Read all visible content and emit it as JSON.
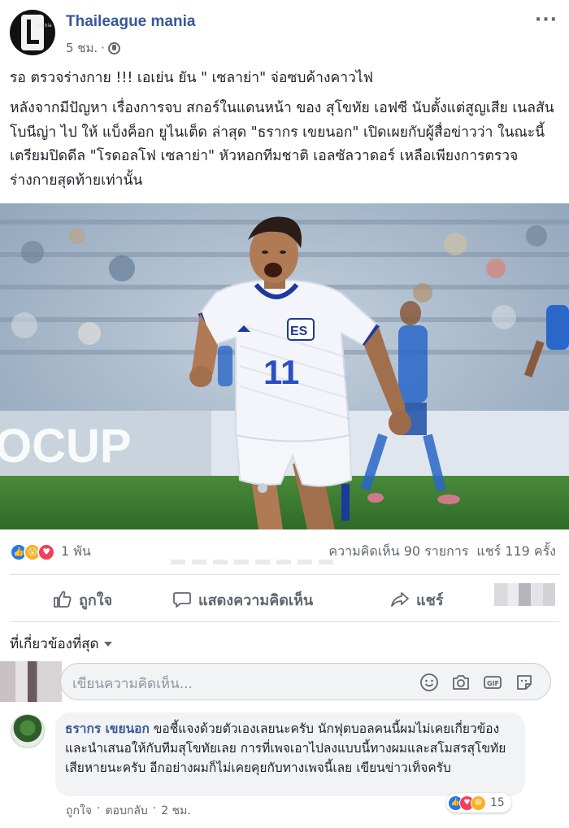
{
  "page": {
    "name": "Thaileague mania",
    "logo_text": "mania",
    "time": "5 ชม.",
    "dot": "·"
  },
  "post": {
    "title": "รอ ตรวจร่างกาย !!! เอเย่น ยัน \" เซลาย่า\" จ่อซบค้างคาวไฟ",
    "body": "หลังจากมีปัญหา เรื่องการจบ สกอร์ในแดนหน้า ของ สุโขทัย เอฟซี นับตั้งแต่สูญเสีย เนลสัน โบนีญ่า ไป ให้ แบ็งค็อก ยูไนเต็ด ล่าสุด \"ธรากร เขยนอก\" เปิดเผยกับผู้สื่อข่าวว่า ในณะนี้ เตรียมปิดดีล \"โรดอลโฟ เซลาย่า\" หัวหอกทีมชาติ เอลซัลวาดอร์ เหลือเพียงการตรวจร่างกายสุดท้ายเท่านั้น",
    "photo": {
      "jersey_text": "ES",
      "jersey_number": "11",
      "banner_text": "OCUP"
    }
  },
  "stats": {
    "reactions_count": "1 พัน",
    "comments": "ความคิดเห็น 90 รายการ",
    "shares": "แชร์ 119 ครั้ง"
  },
  "actions": {
    "like": "ถูกใจ",
    "comment": "แสดงความคิดเห็น",
    "share": "แชร์"
  },
  "comments_section": {
    "sort_label": "ที่เกี่ยวข้องที่สุด",
    "placeholder": "เขียนความคิดเห็น..."
  },
  "reply": {
    "author": "ธรากร เขยนอก",
    "text": "ขอชี้แจงด้วยตัวเองเลยนะครับ นักฟุตบอลคนนี้ผมไม่เคยเกี่ยวข้อง และนำเสนอให้กับทีมสุโขทัยเลย การที่เพจเอาไปลงแบบนี้ทางผมและสโมสรสุโขทัยเสียหายนะครับ อีกอย่างผมก็ไม่เคยคุยกับทางเพจนี้เลย เขียนข่าวเท็จครับ",
    "reaction_count": "15",
    "like": "ถูกใจ",
    "reply": "ตอบกลับ",
    "time": "2 ชม.",
    "sep": "·"
  },
  "colors": {
    "link_blue": "#385898",
    "text": "#1d2129",
    "secondary": "#616770",
    "like_blue": "#2078f4",
    "love_red": "#f33e58",
    "wow_yellow": "#f7b125"
  },
  "icons": [
    "globe-icon",
    "more-icon",
    "like-icon",
    "comment-icon",
    "share-icon",
    "caret-icon",
    "emoji-icon",
    "camera-icon",
    "gif-icon",
    "sticker-icon"
  ]
}
